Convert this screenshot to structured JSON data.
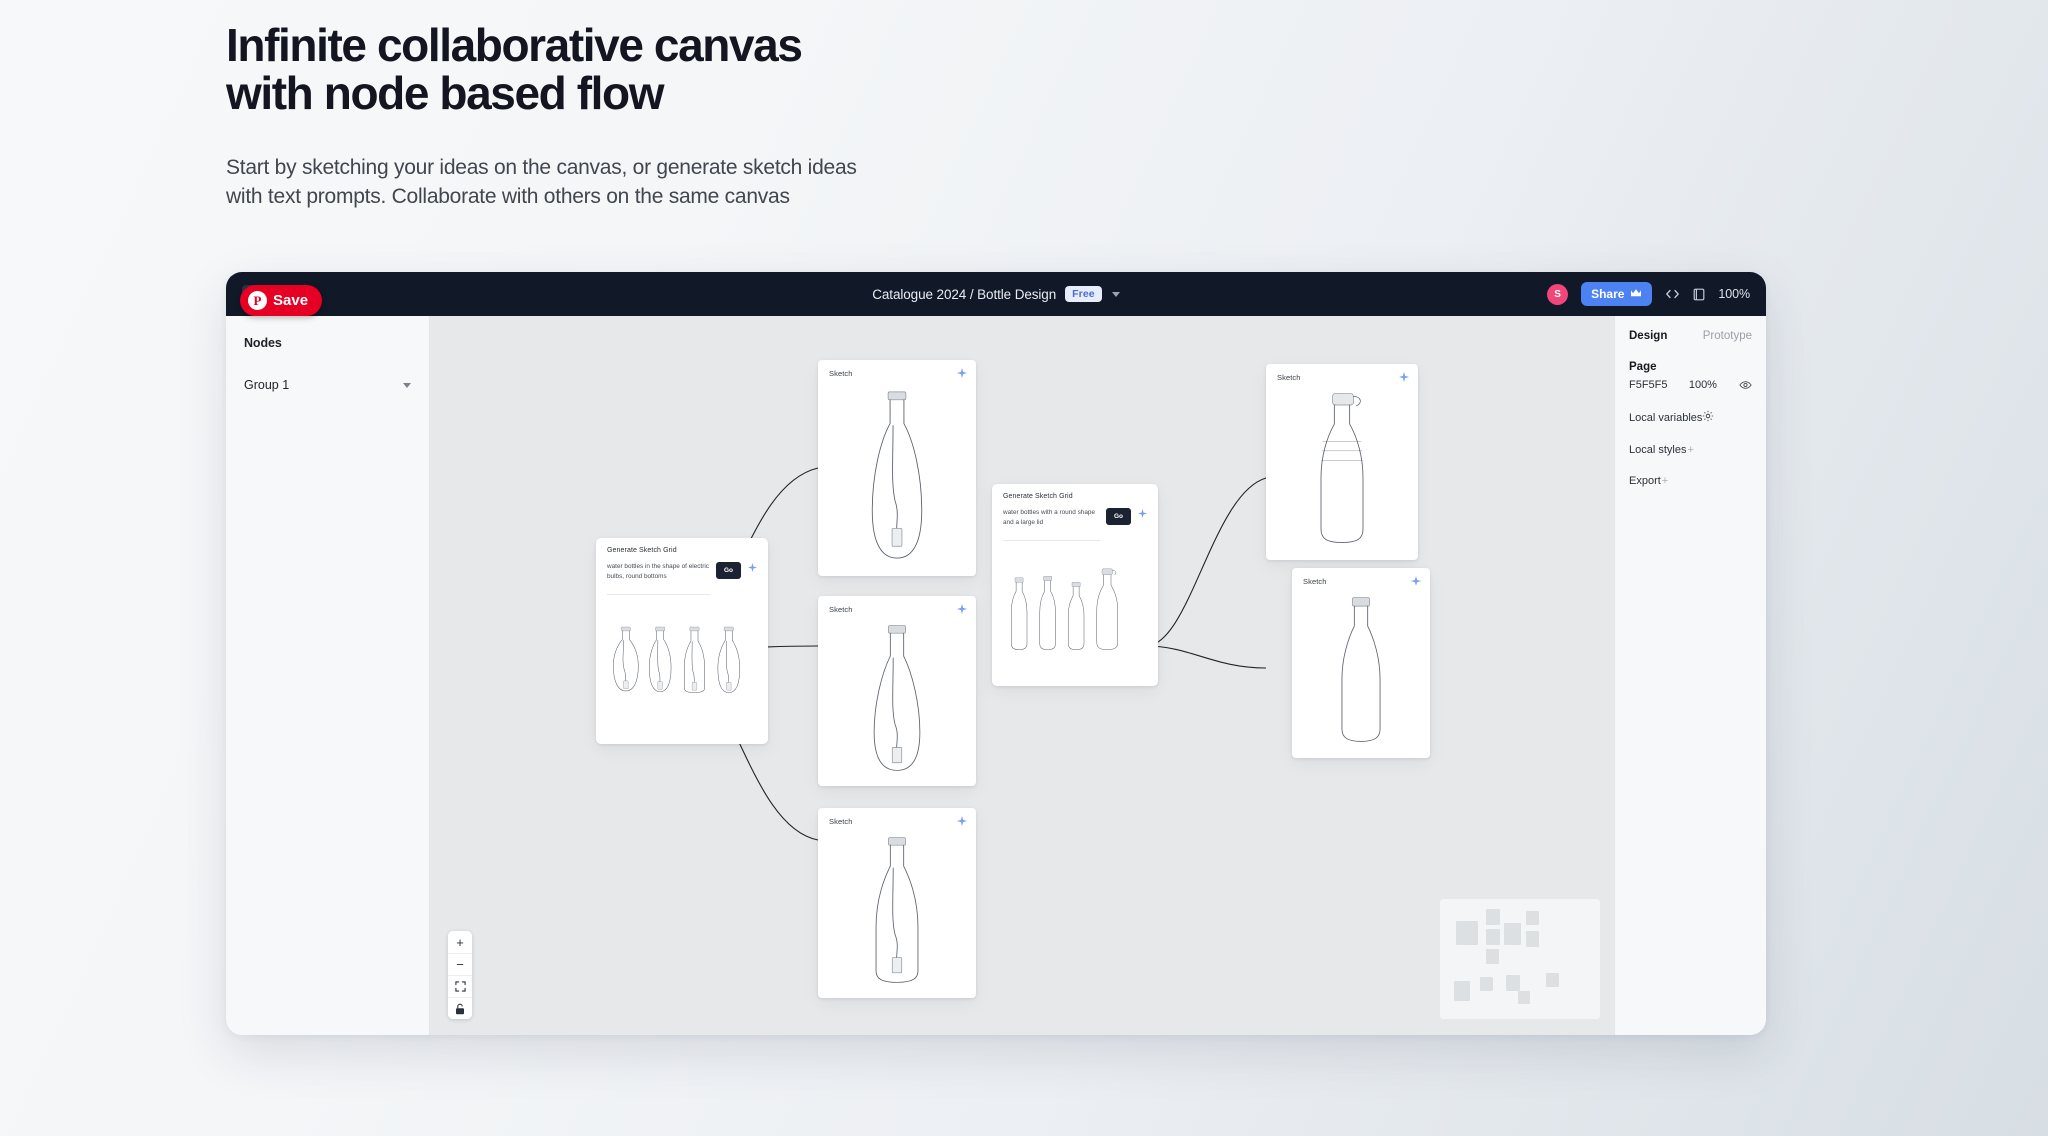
{
  "hero": {
    "title_line1": "Infinite collaborative canvas",
    "title_line2": "with node based flow",
    "subtitle_line1": "Start by sketching your ideas on the canvas, or generate sketch ideas",
    "subtitle_line2": "with text prompts. Collaborate with others on the same canvas"
  },
  "pinterest_overlay": {
    "label": "Save",
    "mark": "P",
    "color": "#e60023"
  },
  "topbar": {
    "doc_title": "Catalogue 2024 / Bottle Design",
    "plan_badge": "Free",
    "avatar_initial": "S",
    "avatar_color": "#f0467a",
    "share_label": "Share",
    "share_color": "#4d82f3",
    "zoom_level": "100%",
    "icons": [
      "code-icon",
      "present-icon"
    ]
  },
  "sidebar_left": {
    "heading": "Nodes",
    "group_label": "Group 1"
  },
  "sidebar_right": {
    "tab_design": "Design",
    "tab_prototype": "Prototype",
    "page_label": "Page",
    "page_color": "F5F5F5",
    "page_opacity": "100%",
    "local_variables": "Local variables",
    "local_styles": "Local styles",
    "local_styles_plus": "+",
    "export": "Export",
    "export_plus": "+"
  },
  "canvas": {
    "zoom_controls": {
      "zoom_in": "+",
      "zoom_out": "−",
      "fit": "fit-to-screen-icon",
      "lock": "lock-icon"
    },
    "generators": [
      {
        "title": "Generate Sketch Grid",
        "prompt": "water bottles in the shape of electric bulbs, round bottoms",
        "go_label": "Go"
      },
      {
        "title": "Generate Sketch Grid",
        "prompt": "water bottles with a round shape and a large lid",
        "go_label": "Go"
      }
    ],
    "sketch_nodes": [
      {
        "label": "Sketch",
        "kind": "bulb-bottle-tall"
      },
      {
        "label": "Sketch",
        "kind": "bulb-bottle-slim"
      },
      {
        "label": "Sketch",
        "kind": "bulb-bottle-round"
      },
      {
        "label": "Sketch",
        "kind": "ribbed-bottle-loop-lid"
      },
      {
        "label": "Sketch",
        "kind": "round-bottle-plain"
      }
    ]
  }
}
